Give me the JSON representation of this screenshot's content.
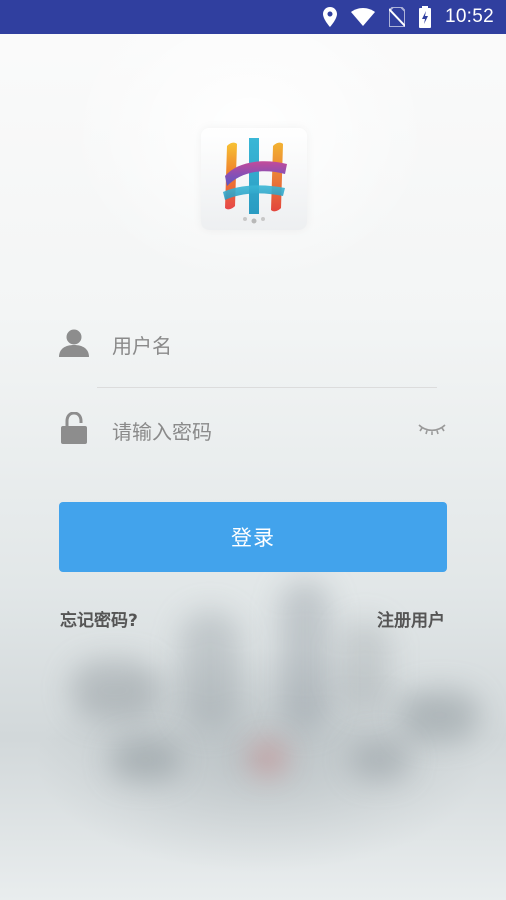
{
  "status_bar": {
    "time": "10:52",
    "icons": [
      "location-icon",
      "wifi-icon",
      "no-sim-icon",
      "battery-charging-icon"
    ]
  },
  "app": {
    "logo": "app-logo"
  },
  "form": {
    "username": {
      "placeholder": "用户名",
      "icon": "user-icon"
    },
    "password": {
      "placeholder": "请输入密码",
      "icon": "lock-icon",
      "toggle_icon": "eye-closed-icon"
    },
    "login_label": "登录",
    "forgot_label": "忘记密码?",
    "register_label": "注册用户"
  },
  "colors": {
    "status_bar": "#303f9f",
    "button": "#42a3ec",
    "placeholder": "#8a8a8a",
    "link": "#555555"
  }
}
